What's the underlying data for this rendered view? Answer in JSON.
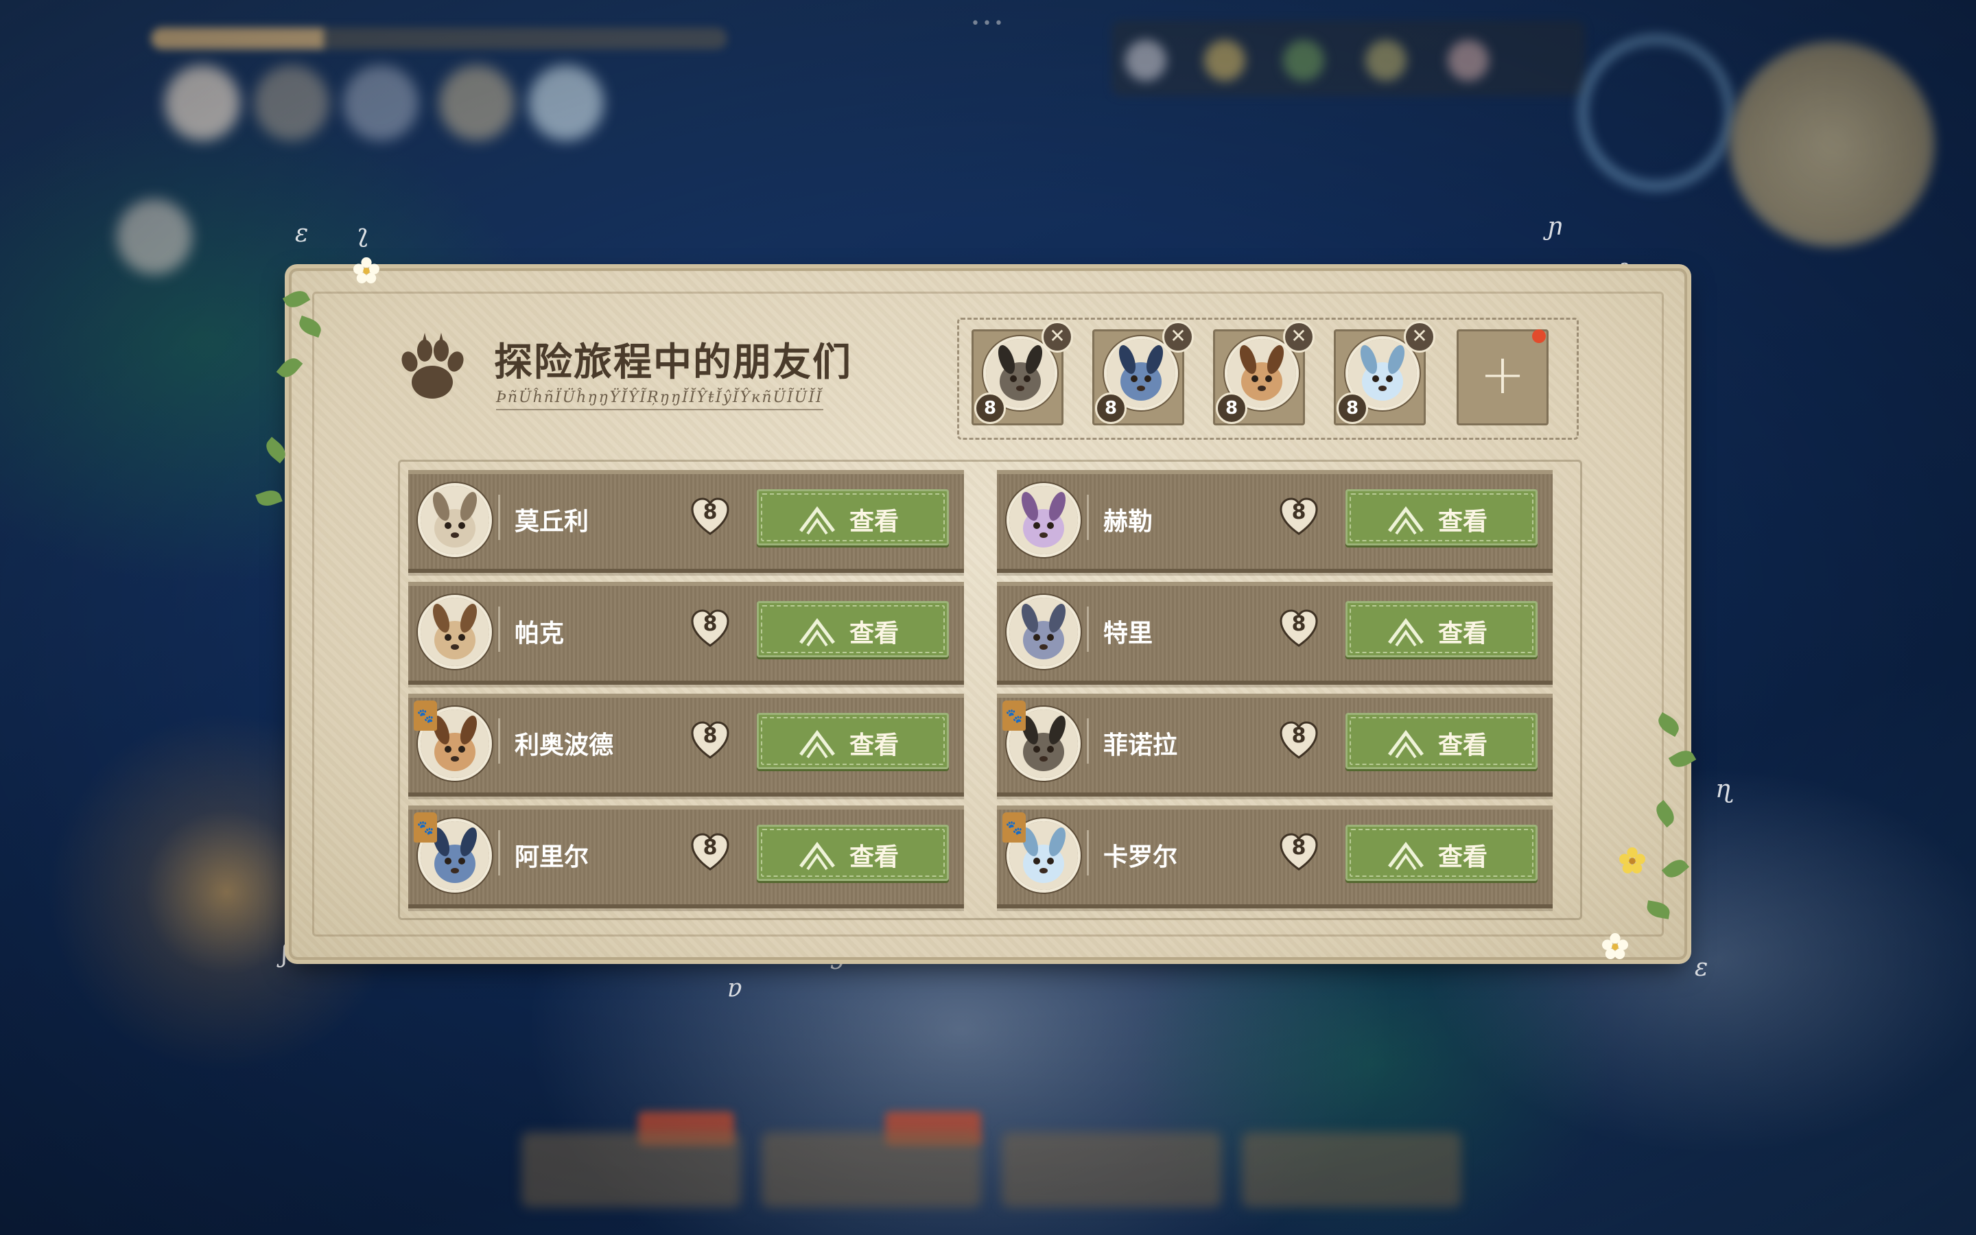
{
  "panel": {
    "title": "探险旅程中的朋友们",
    "subtitle": "ÞñÜĥñÏÜĥŋŋŸĬŶĨŖŋŋĬĬŶŧĬŷĬŶĸñÜĨÜĬĬ"
  },
  "party": {
    "members": [
      {
        "name": "菲诺拉",
        "level": "8",
        "avatar_icon": "wolf-portrait-icon",
        "remove_icon": "close-icon"
      },
      {
        "name": "阿里尔",
        "level": "8",
        "avatar_icon": "blue-beast-portrait-icon",
        "remove_icon": "close-icon"
      },
      {
        "name": "利奥波德",
        "level": "8",
        "avatar_icon": "fawn-portrait-icon",
        "remove_icon": "close-icon"
      },
      {
        "name": "卡罗尔",
        "level": "8",
        "avatar_icon": "ice-creature-portrait-icon",
        "remove_icon": "close-icon"
      }
    ],
    "add_label": "+",
    "add_has_notification": true
  },
  "friends": [
    {
      "name": "莫丘利",
      "affinity": "8",
      "button": "查看",
      "in_party": false,
      "avatar_icon": "rabbit-portrait-icon",
      "col": 0,
      "row": 0
    },
    {
      "name": "赫勒",
      "affinity": "8",
      "button": "查看",
      "in_party": false,
      "avatar_icon": "sheep-portrait-icon",
      "col": 1,
      "row": 0
    },
    {
      "name": "帕克",
      "affinity": "8",
      "button": "查看",
      "in_party": false,
      "avatar_icon": "deer-portrait-icon",
      "col": 0,
      "row": 1
    },
    {
      "name": "特里",
      "affinity": "8",
      "button": "查看",
      "in_party": false,
      "avatar_icon": "bear-portrait-icon",
      "col": 1,
      "row": 1
    },
    {
      "name": "利奥波德",
      "affinity": "8",
      "button": "查看",
      "in_party": true,
      "avatar_icon": "fawn-portrait-icon",
      "col": 0,
      "row": 2
    },
    {
      "name": "菲诺拉",
      "affinity": "8",
      "button": "查看",
      "in_party": true,
      "avatar_icon": "wolf-portrait-icon",
      "col": 1,
      "row": 2
    },
    {
      "name": "阿里尔",
      "affinity": "8",
      "button": "查看",
      "in_party": true,
      "avatar_icon": "blue-beast-portrait-icon",
      "col": 0,
      "row": 3
    },
    {
      "name": "卡罗尔",
      "affinity": "8",
      "button": "查看",
      "in_party": true,
      "avatar_icon": "ice-creature-portrait-icon",
      "col": 1,
      "row": 3
    }
  ],
  "colors": {
    "parchment": "#e4dac3",
    "row_bg": "#8b7b62",
    "button_green": "#7b9a4d",
    "title_text": "#4a3b2b",
    "notification_red": "#e24b2c",
    "party_badge": "#c48a3e"
  }
}
